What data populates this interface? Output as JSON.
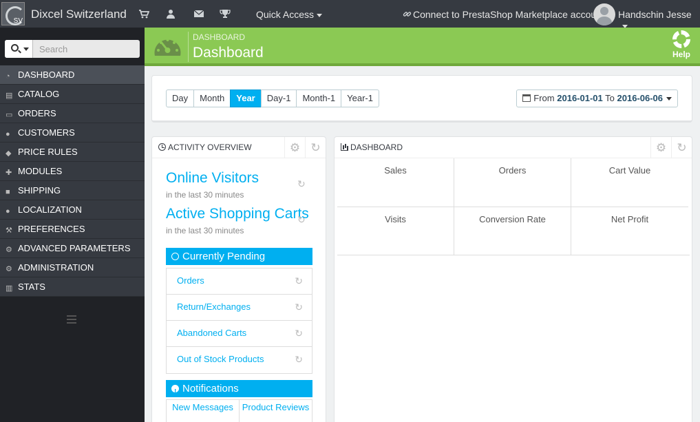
{
  "topbar": {
    "logo_text": "SV",
    "shop_name": "Dixcel Switzerland",
    "quick_access": "Quick Access",
    "connect": "Connect to PrestaShop Marketplace account",
    "user": "Handschin Jesse"
  },
  "sidebar": {
    "search_placeholder": "Search",
    "items": [
      {
        "label": "DASHBOARD",
        "icon": "dashboard-icon",
        "active": true
      },
      {
        "label": "CATALOG",
        "icon": "book-icon"
      },
      {
        "label": "ORDERS",
        "icon": "credit-card-icon"
      },
      {
        "label": "CUSTOMERS",
        "icon": "users-icon"
      },
      {
        "label": "PRICE RULES",
        "icon": "tags-icon"
      },
      {
        "label": "MODULES",
        "icon": "puzzle-icon"
      },
      {
        "label": "SHIPPING",
        "icon": "truck-icon"
      },
      {
        "label": "LOCALIZATION",
        "icon": "globe-icon"
      },
      {
        "label": "PREFERENCES",
        "icon": "wrench-icon"
      },
      {
        "label": "ADVANCED PARAMETERS",
        "icon": "cogs-icon"
      },
      {
        "label": "ADMINISTRATION",
        "icon": "cog-icon"
      },
      {
        "label": "STATS",
        "icon": "bar-chart-icon"
      }
    ]
  },
  "header": {
    "breadcrumb": "DASHBOARD",
    "title": "Dashboard",
    "help": "Help"
  },
  "filters": {
    "periods": [
      "Day",
      "Month",
      "Year",
      "Day-1",
      "Month-1",
      "Year-1"
    ],
    "active_period": "Year",
    "from_label": "From",
    "from_date": "2016-01-01",
    "to_label": "To",
    "to_date": "2016-06-06"
  },
  "activity": {
    "title": "Activity overview",
    "online_visitors": "Online Visitors",
    "visitors_sub": "in the last 30 minutes",
    "active_carts": "Active Shopping Carts",
    "carts_sub": "in the last 30 minutes",
    "pending_title": "Currently Pending",
    "pending_items": [
      "Orders",
      "Return/Exchanges",
      "Abandoned Carts",
      "Out of Stock Products"
    ],
    "notifications_title": "Notifications",
    "notification_tabs": [
      "New Messages",
      "Product Reviews"
    ]
  },
  "dashboard": {
    "title": "Dashboard",
    "kpis": [
      "Sales",
      "Orders",
      "Cart Value",
      "Visits",
      "Conversion Rate",
      "Net Profit"
    ]
  },
  "colors": {
    "accent": "#00aff0",
    "header_green": "#8bc954",
    "topbar": "#363a41"
  }
}
